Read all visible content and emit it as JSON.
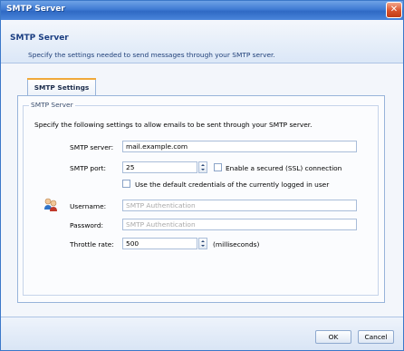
{
  "window": {
    "title": "SMTP Server",
    "close_glyph": "✕"
  },
  "header": {
    "title": "SMTP Server",
    "subtitle": "Specify the settings needed to send messages through your SMTP server."
  },
  "tab": {
    "label": "SMTP Settings"
  },
  "group": {
    "caption": "SMTP Server",
    "intro": "Specify the following settings to allow emails to be sent through your SMTP server."
  },
  "form": {
    "server": {
      "label": "SMTP server:",
      "value": "mail.example.com"
    },
    "port": {
      "label": "SMTP port:",
      "value": "25"
    },
    "ssl": {
      "label": "Enable a secured (SSL) connection",
      "checked": false
    },
    "default_credentials": {
      "label": "Use the default credentials of the currently logged in user",
      "checked": false
    },
    "username": {
      "label": "Username:",
      "placeholder": "SMTP Authentication"
    },
    "password": {
      "label": "Password:",
      "placeholder": "SMTP Authentication"
    },
    "throttle": {
      "label": "Throttle rate:",
      "value": "500",
      "unit": "(milliseconds)"
    }
  },
  "buttons": {
    "ok": "OK",
    "cancel": "Cancel"
  },
  "icons": {
    "users": "users-icon",
    "close": "close-icon"
  },
  "colors": {
    "title_bar": "#3f7bd3",
    "header_title": "#1b3e82",
    "tab_accent": "#f0a93a",
    "close_button": "#d9532c"
  }
}
